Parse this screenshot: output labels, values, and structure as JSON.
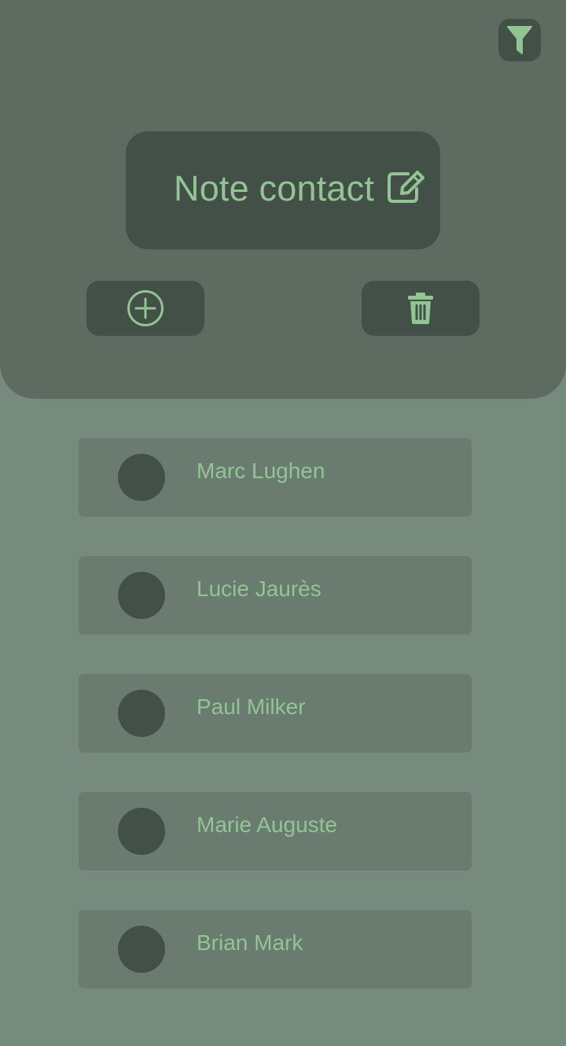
{
  "app": {
    "title": "Note contact"
  },
  "toolbar": {
    "filter_icon": "filter-icon",
    "edit_icon": "edit-icon",
    "add_icon": "add-circle-icon",
    "delete_icon": "trash-icon"
  },
  "contacts": [
    {
      "name": "Marc Lughen"
    },
    {
      "name": "Lucie Jaurès"
    },
    {
      "name": "Paul Milker"
    },
    {
      "name": "Marie Auguste"
    },
    {
      "name": "Brian Mark"
    }
  ],
  "colors": {
    "background": "#768a7d",
    "header": "#5e6b61",
    "dark_surface": "#435047",
    "list_item": "#6a7b70",
    "accent": "#93c493"
  }
}
